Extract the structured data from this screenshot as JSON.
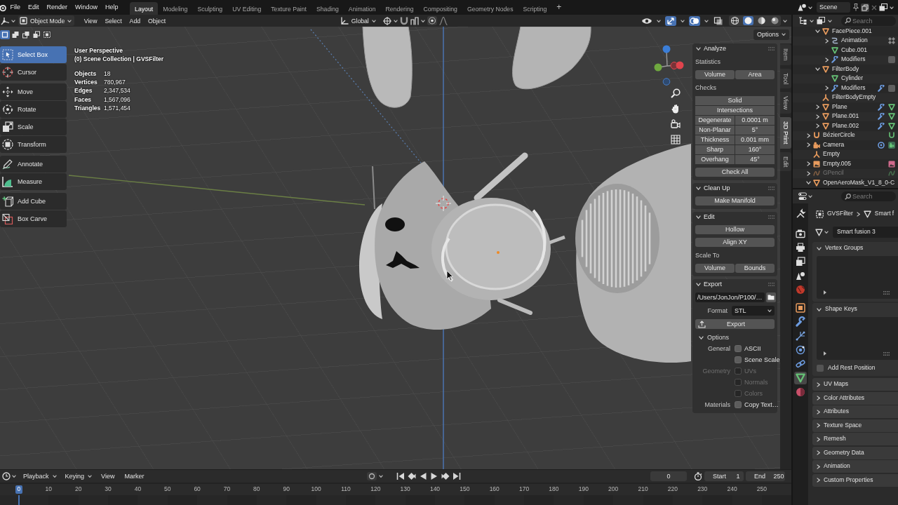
{
  "top_bar": {
    "menus": [
      "File",
      "Edit",
      "Render",
      "Window",
      "Help"
    ],
    "workspaces": [
      {
        "label": "Layout",
        "selected": true
      },
      {
        "label": "Modeling",
        "selected": false
      },
      {
        "label": "Sculpting",
        "selected": false
      },
      {
        "label": "UV Editing",
        "selected": false
      },
      {
        "label": "Texture Paint",
        "selected": false
      },
      {
        "label": "Shading",
        "selected": false
      },
      {
        "label": "Animation",
        "selected": false
      },
      {
        "label": "Rendering",
        "selected": false
      },
      {
        "label": "Compositing",
        "selected": false
      },
      {
        "label": "Geometry Nodes",
        "selected": false
      },
      {
        "label": "Scripting",
        "selected": false
      }
    ],
    "add_workspace": "+",
    "scene": "Scene"
  },
  "viewport": {
    "header": {
      "mode": "Object Mode",
      "menus": [
        "View",
        "Select",
        "Add",
        "Object"
      ],
      "orientation": "Global",
      "toggles": [
        {
          "kind": "visibility",
          "on": false
        },
        {
          "kind": "gizmo",
          "on": true
        },
        {
          "kind": "overlay",
          "on": true
        },
        {
          "kind": "xray",
          "on": false
        }
      ],
      "shading": [
        {
          "kind": "wireframe",
          "selected": false
        },
        {
          "kind": "solid",
          "selected": true
        },
        {
          "kind": "material",
          "selected": false
        },
        {
          "kind": "rendered",
          "selected": false
        }
      ]
    },
    "select_modes": [
      {
        "kind": "set",
        "selected": true
      },
      {
        "kind": "extend",
        "selected": false
      },
      {
        "kind": "subtract",
        "selected": false
      },
      {
        "kind": "invert",
        "selected": false
      },
      {
        "kind": "intersect",
        "selected": false
      }
    ],
    "options": "Options",
    "tool_groups": [
      [
        {
          "kind": "select_box",
          "label": "Select Box",
          "selected": true
        },
        {
          "kind": "cursor",
          "label": "Cursor",
          "selected": false
        }
      ],
      [
        {
          "kind": "move",
          "label": "Move",
          "selected": false
        },
        {
          "kind": "rotate",
          "label": "Rotate",
          "selected": false
        },
        {
          "kind": "scale",
          "label": "Scale",
          "selected": false
        },
        {
          "kind": "transform",
          "label": "Transform",
          "selected": false
        }
      ],
      [
        {
          "kind": "annotate",
          "label": "Annotate",
          "selected": false
        },
        {
          "kind": "measure",
          "label": "Measure",
          "selected": false
        }
      ],
      [
        {
          "kind": "add_cube",
          "label": "Add Cube",
          "selected": false
        },
        {
          "kind": "box_carve",
          "label": "Box Carve",
          "selected": false
        }
      ]
    ],
    "view_name": "User Perspective",
    "collection": "(0) Scene Collection | GVSFilter",
    "stats": [
      {
        "label": "Objects",
        "value": "18"
      },
      {
        "label": "Vertices",
        "value": "780,967"
      },
      {
        "label": "Edges",
        "value": "2,347,534"
      },
      {
        "label": "Faces",
        "value": "1,567,096"
      },
      {
        "label": "Triangles",
        "value": "1,571,454"
      }
    ]
  },
  "sidebar": {
    "tabs": [
      {
        "label": "Item",
        "selected": false
      },
      {
        "label": "Tool",
        "selected": false
      },
      {
        "label": "View",
        "selected": false
      },
      {
        "label": "3D Print",
        "selected": true
      },
      {
        "label": "Edit",
        "selected": false
      }
    ],
    "panels": [
      {
        "title": "Analyze",
        "expanded": true,
        "rows": [
          {
            "kind": "label",
            "text": "Statistics"
          },
          {
            "kind": "buttons",
            "buttons": [
              "Volume",
              "Area"
            ]
          },
          {
            "kind": "label",
            "text": "Checks"
          },
          {
            "kind": "group",
            "rows": [
              {
                "kind": "buttons",
                "buttons": [
                  "Solid"
                ]
              },
              {
                "kind": "buttons",
                "buttons": [
                  "Intersections"
                ]
              },
              {
                "kind": "pair",
                "label": "Degenerate",
                "value": "0.0001 m"
              },
              {
                "kind": "pair",
                "label": "Non-Planar",
                "value": "5°"
              },
              {
                "kind": "pair",
                "label": "Thickness",
                "value": "0.001 mm"
              },
              {
                "kind": "pair",
                "label": "Sharp",
                "value": "160°"
              },
              {
                "kind": "pair",
                "label": "Overhang",
                "value": "45°"
              }
            ]
          },
          {
            "kind": "buttons",
            "buttons": [
              "Check All"
            ]
          }
        ]
      },
      {
        "title": "Clean Up",
        "expanded": true,
        "rows": [
          {
            "kind": "buttons",
            "buttons": [
              "Make Manifold"
            ]
          }
        ]
      },
      {
        "title": "Edit",
        "expanded": true,
        "rows": [
          {
            "kind": "buttons",
            "buttons": [
              "Hollow"
            ]
          },
          {
            "kind": "buttons",
            "buttons": [
              "Align XY"
            ]
          },
          {
            "kind": "label",
            "text": "Scale To"
          },
          {
            "kind": "buttons",
            "buttons": [
              "Volume",
              "Bounds"
            ]
          }
        ]
      },
      {
        "title": "Export",
        "expanded": true,
        "rows": [
          {
            "kind": "file",
            "value": "/Users/JonJon/P100/…"
          },
          {
            "kind": "select",
            "label": "Format",
            "value": "STL"
          },
          {
            "kind": "action",
            "label": "Export"
          },
          {
            "kind": "subpanel",
            "title": "Options",
            "expanded": true
          },
          {
            "kind": "check",
            "label": "General",
            "text": "ASCII",
            "checked": false,
            "disabled": false
          },
          {
            "kind": "check",
            "text": "Scene Scale",
            "checked": false,
            "disabled": false
          },
          {
            "kind": "check",
            "label": "Geometry",
            "text": "UVs",
            "checked": false,
            "disabled": true
          },
          {
            "kind": "check",
            "text": "Normals",
            "checked": false,
            "disabled": true
          },
          {
            "kind": "check",
            "text": "Colors",
            "checked": false,
            "disabled": true
          },
          {
            "kind": "check",
            "label": "Materials",
            "text": "Copy Text…",
            "checked": false,
            "disabled": false
          }
        ]
      }
    ]
  },
  "outliner": {
    "search_placeholder": "Search",
    "tree": [
      {
        "children": [
          {
            "label": "FacePiece.001",
            "kind": "mesh_object",
            "expanded": true,
            "disabled": false,
            "children": [
              {
                "label": "Animation",
                "kind": "animation",
                "expanded": false,
                "disabled": false,
                "extras": [
                  {
                    "kind": "nla"
                  }
                ]
              },
              {
                "label": "Cube.001",
                "kind": "mesh",
                "disabled": false
              },
              {
                "label": "Modifiers",
                "kind": "modifiers",
                "expanded": false,
                "disabled": false,
                "extras": [
                  {
                    "kind": "toggle"
                  }
                ]
              }
            ]
          },
          {
            "label": "FilterBody",
            "kind": "mesh_object",
            "expanded": true,
            "disabled": false,
            "children": [
              {
                "label": "Cylinder",
                "kind": "mesh",
                "disabled": false
              },
              {
                "label": "Modifiers",
                "kind": "modifiers",
                "expanded": false,
                "disabled": false,
                "extras": [
                  {
                    "kind": "wrench"
                  },
                  {
                    "kind": "toggle"
                  }
                ]
              }
            ]
          },
          {
            "label": "FilterBodyEmpty",
            "kind": "empty",
            "disabled": false
          },
          {
            "label": "Plane",
            "kind": "mesh_object",
            "expanded": false,
            "disabled": false,
            "extras": [
              {
                "kind": "wrench"
              },
              {
                "kind": "mesh"
              }
            ]
          },
          {
            "label": "Plane.001",
            "kind": "mesh_object",
            "expanded": false,
            "disabled": false,
            "extras": [
              {
                "kind": "wrench"
              },
              {
                "kind": "mesh"
              }
            ]
          },
          {
            "label": "Plane.002",
            "kind": "mesh_object",
            "expanded": false,
            "disabled": false,
            "extras": [
              {
                "kind": "wrench"
              },
              {
                "kind": "mesh"
              }
            ]
          }
        ]
      },
      {
        "label": "BézierCircle",
        "kind": "curve_object",
        "expanded": false,
        "disabled": false,
        "extras": [
          {
            "kind": "curve"
          }
        ]
      },
      {
        "label": "Camera",
        "kind": "camera_object",
        "expanded": false,
        "disabled": false,
        "extras": [
          {
            "kind": "orbit"
          },
          {
            "kind": "camera_data"
          }
        ]
      },
      {
        "label": "Empty",
        "kind": "empty",
        "disabled": false
      },
      {
        "label": "Empty.005",
        "kind": "image_empty",
        "expanded": false,
        "disabled": false,
        "extras": [
          {
            "kind": "image"
          }
        ]
      },
      {
        "label": "GPencil",
        "kind": "gpencil_object",
        "expanded": false,
        "disabled": true,
        "extras": [
          {
            "kind": "gpencil"
          }
        ]
      },
      {
        "label": "OpenAeroMask_V1_8_0-C",
        "kind": "mesh_object",
        "expanded": true,
        "disabled": false
      }
    ]
  },
  "properties": {
    "search_placeholder": "Search",
    "tab_groups": [
      [
        {
          "kind": "tool",
          "selected": false
        }
      ],
      [
        {
          "kind": "render",
          "selected": false
        },
        {
          "kind": "output",
          "selected": false
        },
        {
          "kind": "view_layer",
          "selected": false
        },
        {
          "kind": "scene",
          "selected": false
        },
        {
          "kind": "world",
          "selected": false
        }
      ],
      [
        {
          "kind": "object",
          "selected": false
        },
        {
          "kind": "modifiers",
          "selected": false
        },
        {
          "kind": "particles",
          "selected": false
        },
        {
          "kind": "physics",
          "selected": false
        },
        {
          "kind": "constraints",
          "selected": false
        },
        {
          "kind": "data",
          "selected": true
        },
        {
          "kind": "material",
          "selected": false
        }
      ]
    ],
    "breadcrumb": [
      {
        "kind": "object",
        "label": "GVSFilter"
      },
      {
        "kind": "mesh",
        "label": "Smart f"
      }
    ],
    "datablock": "Smart fusion 3",
    "panels": [
      {
        "title": "Vertex Groups",
        "expanded": true
      },
      {
        "title": "Shape Keys",
        "expanded": true,
        "option": {
          "label": "Add Rest Position",
          "checked": false
        }
      },
      {
        "title": "UV Maps",
        "expanded": false
      },
      {
        "title": "Color Attributes",
        "expanded": false
      },
      {
        "title": "Attributes",
        "expanded": false
      },
      {
        "title": "Texture Space",
        "expanded": false
      },
      {
        "title": "Remesh",
        "expanded": false
      },
      {
        "title": "Geometry Data",
        "expanded": false
      },
      {
        "title": "Animation",
        "expanded": false
      },
      {
        "title": "Custom Properties",
        "expanded": false
      }
    ]
  },
  "timeline": {
    "dropdowns": [
      "Playback",
      "Keying"
    ],
    "menus": [
      "View",
      "Marker"
    ],
    "current_frame": "0",
    "start": {
      "label": "Start",
      "value": "1"
    },
    "end": {
      "label": "End",
      "value": "250"
    },
    "playhead": "0",
    "ruler": [
      "10",
      "20",
      "30",
      "40",
      "50",
      "60",
      "70",
      "80",
      "90",
      "100",
      "110",
      "120",
      "130",
      "140",
      "150",
      "160",
      "170",
      "180",
      "190",
      "200",
      "210",
      "220",
      "230",
      "240",
      "250"
    ]
  }
}
